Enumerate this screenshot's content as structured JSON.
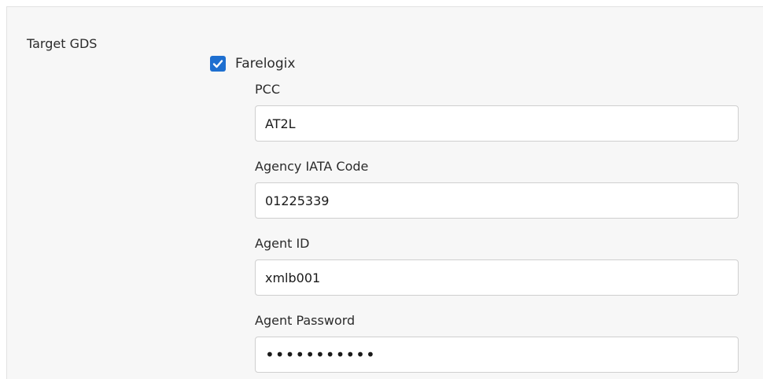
{
  "section": {
    "label": "Target GDS"
  },
  "gds": {
    "option_label": "Farelogix",
    "checked": true
  },
  "fields": {
    "pcc": {
      "label": "PCC",
      "value": "AT2L"
    },
    "iata": {
      "label": "Agency IATA Code",
      "value": "01225339"
    },
    "agent_id": {
      "label": "Agent ID",
      "value": "xmlb001"
    },
    "agent_password": {
      "label": "Agent Password",
      "value": "•••••••••••"
    }
  },
  "colors": {
    "checkbox": "#1e6fd0",
    "panel_bg": "#f7f7f7",
    "input_border": "#cfcfcf"
  },
  "icons": {
    "checkbox": "checkmark-icon"
  }
}
